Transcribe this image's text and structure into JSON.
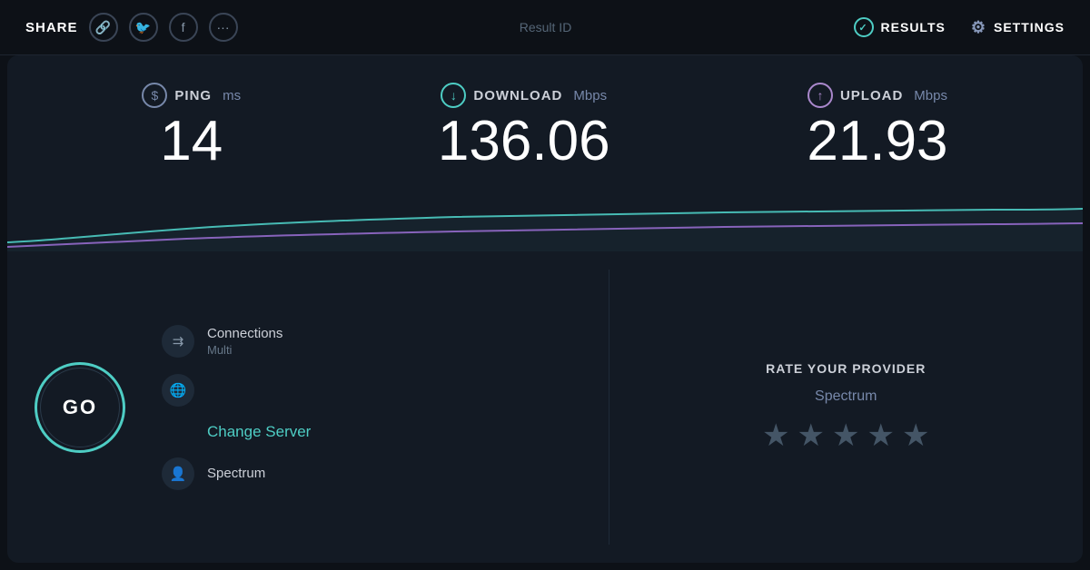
{
  "header": {
    "share_label": "SHARE",
    "result_id_label": "Result ID",
    "results_label": "RESULTS",
    "settings_label": "SETTINGS",
    "social_icons": [
      "🔗",
      "🐦",
      "f",
      "···"
    ]
  },
  "metrics": {
    "ping": {
      "label": "PING",
      "unit": "ms",
      "value": "14",
      "icon": "⊙"
    },
    "download": {
      "label": "DOWNLOAD",
      "unit": "Mbps",
      "value": "136.06",
      "icon": "↓"
    },
    "upload": {
      "label": "UPLOAD",
      "unit": "Mbps",
      "value": "21.93",
      "icon": "↑"
    }
  },
  "actions": {
    "go_label": "GO",
    "change_server_label": "Change Server"
  },
  "info": {
    "connections_label": "Connections",
    "connections_value": "Multi",
    "server_label": "Spectrum"
  },
  "rating": {
    "title": "RATE YOUR PROVIDER",
    "provider": "Spectrum",
    "stars": [
      "★",
      "★",
      "★",
      "★",
      "★"
    ]
  },
  "colors": {
    "cyan": "#4ecdc4",
    "purple": "#9966cc",
    "dark_bg": "#131a24",
    "header_bg": "#0d1117"
  }
}
